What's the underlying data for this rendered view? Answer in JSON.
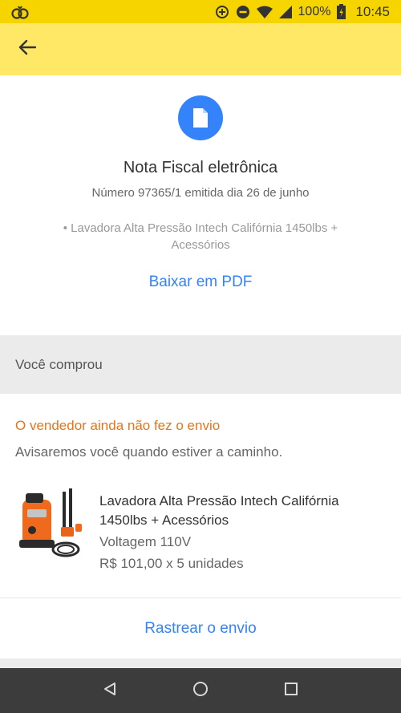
{
  "status_bar": {
    "battery_percent": "100%",
    "time": "10:45",
    "icons": [
      "notification-app-icon",
      "data-saver-icon",
      "do-not-disturb-icon",
      "wifi-icon",
      "signal-icon",
      "battery-icon"
    ]
  },
  "app_bar": {
    "back_icon": "arrow-left-icon"
  },
  "invoice": {
    "icon": "document-icon",
    "title": "Nota Fiscal eletrônica",
    "subtitle": "Número 97365/1 emitida dia 26 de junho",
    "item": "• Lavadora Alta Pressão Intech Califórnia 1450lbs + Acessórios",
    "download_label": "Baixar em PDF"
  },
  "purchase": {
    "section_title": "Você comprou",
    "shipping_status": "O vendedor ainda não fez o envio",
    "shipping_note": "Avisaremos você quando estiver a caminho.",
    "product": {
      "name": "Lavadora Alta Pressão Intech Califórnia 1450lbs + Acessórios",
      "variant": "Voltagem 110V",
      "price": "R$ 101,00 x 5 unidades"
    },
    "track_label": "Rastrear o envio"
  },
  "colors": {
    "status_bar": "#f5d400",
    "app_bar": "#ffe866",
    "accent_blue": "#3483fa",
    "warning_orange": "#e6751a"
  },
  "nav_bar": {
    "buttons": [
      "back-triangle-icon",
      "home-circle-icon",
      "recents-square-icon"
    ]
  }
}
